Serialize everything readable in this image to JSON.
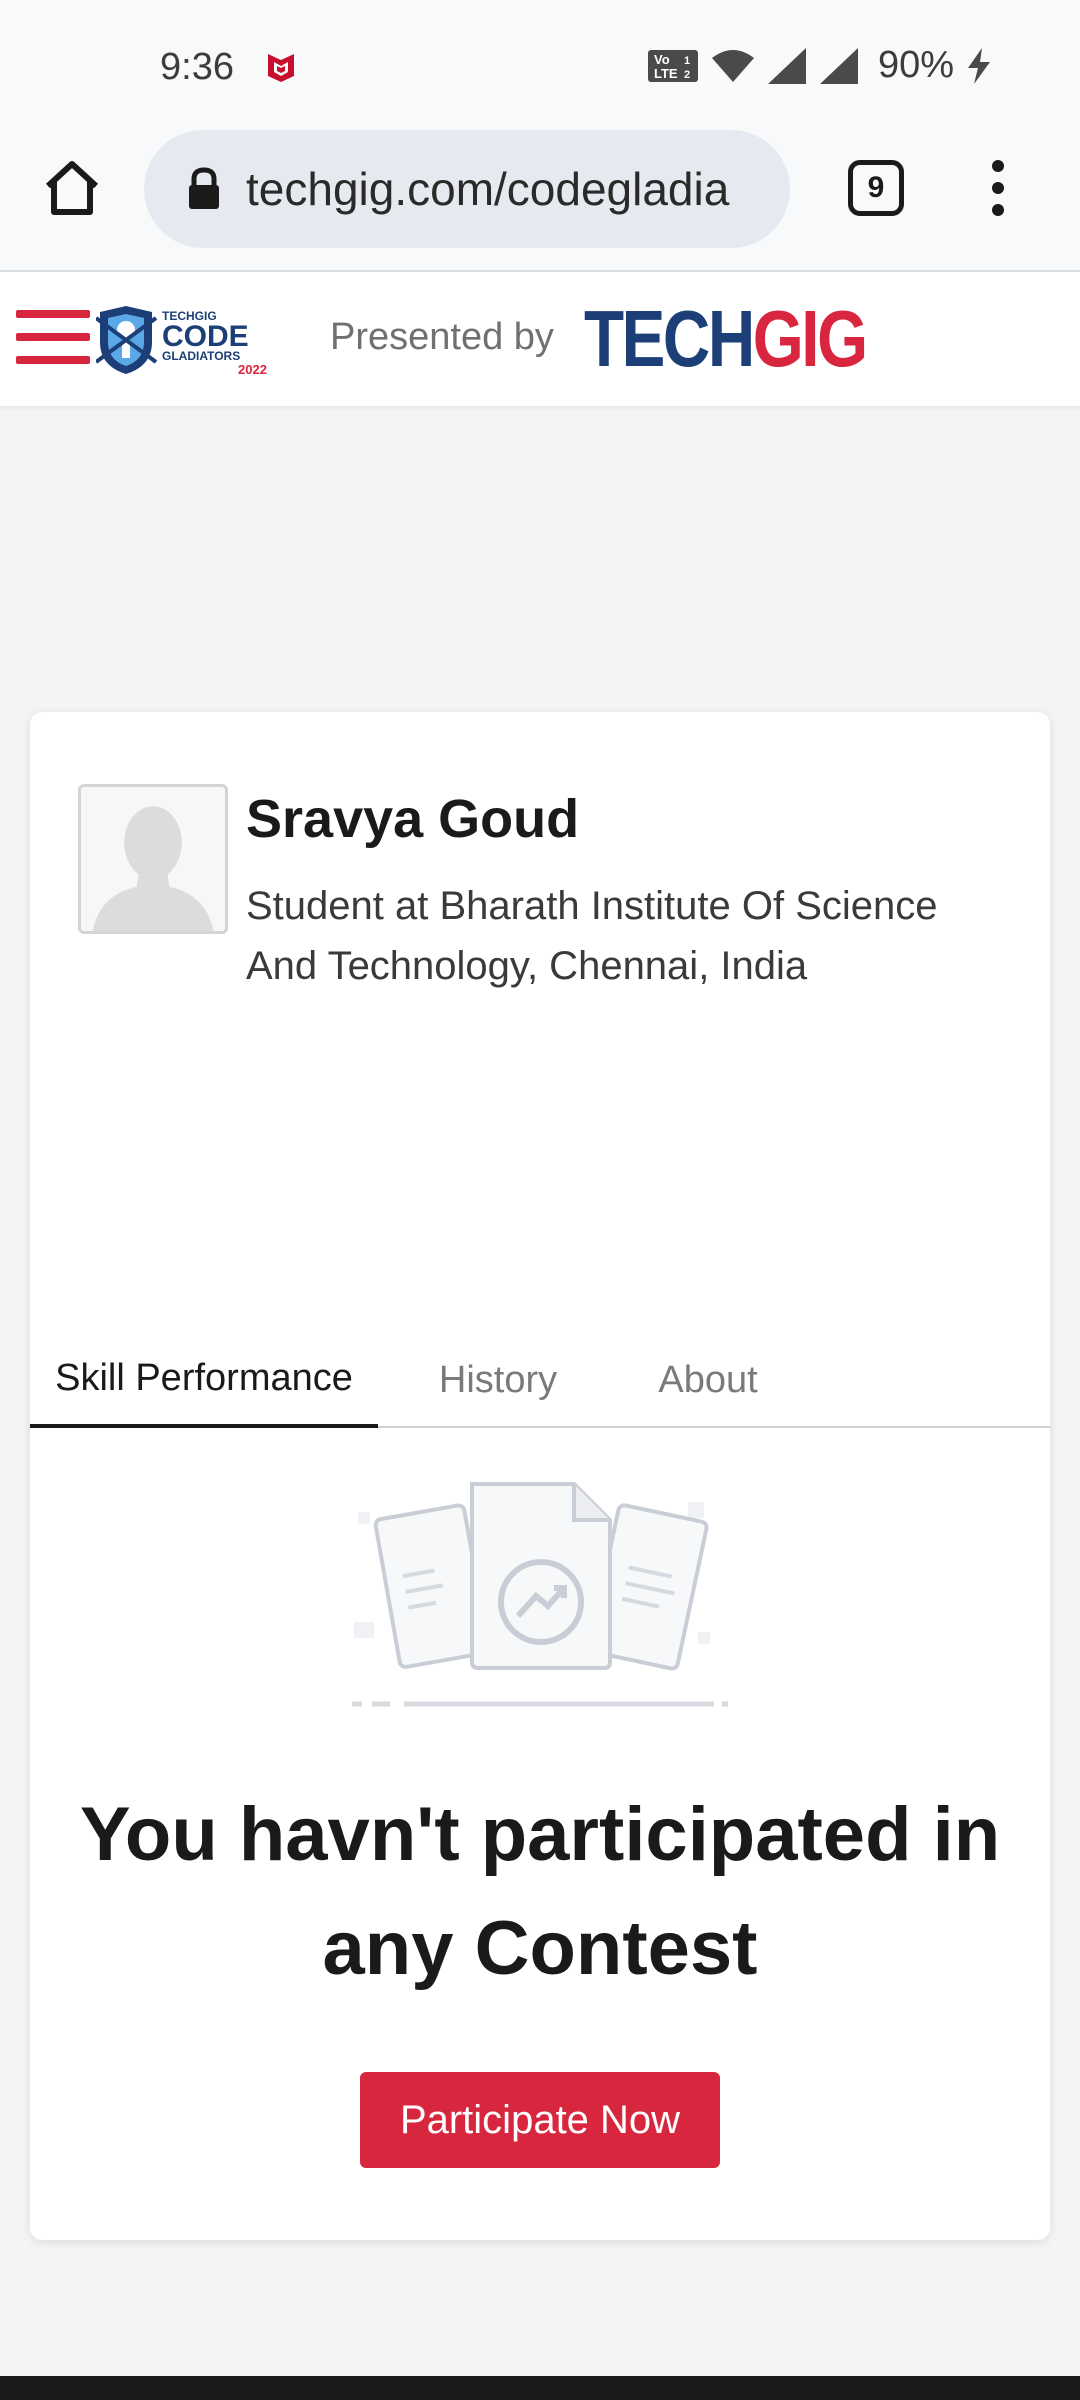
{
  "status_bar": {
    "time": "9:36",
    "battery": "90%",
    "icons": [
      "mcafee-icon",
      "volte-icon",
      "wifi-icon",
      "signal-icon",
      "signal-roaming-icon",
      "charging-bolt-icon"
    ]
  },
  "browser": {
    "url": "techgig.com/codegladia",
    "tab_count": "9",
    "icons": [
      "home-icon",
      "lock-icon",
      "more-vert-icon"
    ]
  },
  "header": {
    "presented_by": "Presented by",
    "logo_text_1": "TECH",
    "logo_text_2": "GIG",
    "event_logo": {
      "small": "TECHGIG",
      "main": "CODE",
      "sub": "GLADIATORS",
      "year": "2022"
    },
    "colors": {
      "brand_red": "#d7263d",
      "brand_blue": "#1d3f77"
    }
  },
  "profile": {
    "name": "Sravya Goud",
    "description": "Student at Bharath Institute Of Science And Technology, Chennai, India"
  },
  "tabs": [
    {
      "label": "Skill Performance",
      "active": true
    },
    {
      "label": "History",
      "active": false
    },
    {
      "label": "About",
      "active": false
    }
  ],
  "empty_state": {
    "message": "You havn't participated in any Contest",
    "button_label": "Participate Now",
    "illustration": "documents-chart-icon"
  }
}
